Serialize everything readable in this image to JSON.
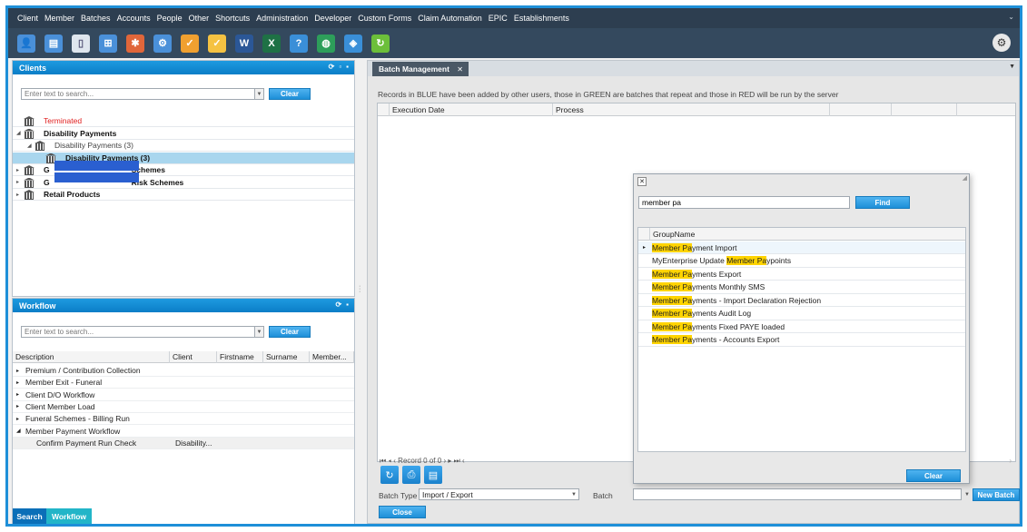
{
  "menu": [
    "Client",
    "Member",
    "Batches",
    "Accounts",
    "People",
    "Other",
    "Shortcuts",
    "Administration",
    "Developer",
    "Custom Forms",
    "Claim Automation",
    "EPIC",
    "Establishments"
  ],
  "toolbar_icons": [
    {
      "name": "people-icon",
      "color": "#4a90d9",
      "glyph": "👤"
    },
    {
      "name": "id-card-icon",
      "color": "#4a90d9",
      "glyph": "▤"
    },
    {
      "name": "document-icon",
      "color": "#dfe6ee",
      "glyph": "▯"
    },
    {
      "name": "hierarchy-icon",
      "color": "#4a90d9",
      "glyph": "⊞"
    },
    {
      "name": "molecule-icon",
      "color": "#e0663a",
      "glyph": "✱"
    },
    {
      "name": "user-settings-icon",
      "color": "#4a90d9",
      "glyph": "⚙"
    },
    {
      "name": "checklist-icon",
      "color": "#f0a030",
      "glyph": "✓"
    },
    {
      "name": "clipboard-check-icon",
      "color": "#f5c242",
      "glyph": "✓"
    },
    {
      "name": "word-icon",
      "color": "#2b5797",
      "glyph": "W"
    },
    {
      "name": "excel-icon",
      "color": "#1e7145",
      "glyph": "X"
    },
    {
      "name": "help-icon",
      "color": "#3a8fd8",
      "glyph": "?"
    },
    {
      "name": "globe-icon",
      "color": "#2d9e5a",
      "glyph": "◍"
    },
    {
      "name": "security-user-icon",
      "color": "#3a8fd8",
      "glyph": "◈"
    },
    {
      "name": "refresh-icon",
      "color": "#6cbf3a",
      "glyph": "↻"
    }
  ],
  "clients": {
    "title": "Clients",
    "search_placeholder": "Enter text to search...",
    "clear_label": "Clear",
    "tree": [
      {
        "label": "Terminated",
        "level": 0,
        "color": "#e02020",
        "bold": false,
        "arrow": "",
        "selected": false
      },
      {
        "label": "Disability Payments",
        "level": 0,
        "color": "#111111",
        "bold": true,
        "arrow": "◢",
        "selected": false
      },
      {
        "label": "Disability Payments (3)",
        "level": 1,
        "color": "#444444",
        "bold": false,
        "arrow": "◢",
        "selected": false
      },
      {
        "label": "Disability Payments (3)",
        "level": 2,
        "color": "#111111",
        "bold": true,
        "arrow": "",
        "selected": true
      },
      {
        "label": "Schemes",
        "level": 0,
        "color": "#111111",
        "bold": true,
        "arrow": "▸",
        "selected": false,
        "redacted": true,
        "prefix": "G"
      },
      {
        "label": "Risk Schemes",
        "level": 0,
        "color": "#111111",
        "bold": true,
        "arrow": "▸",
        "selected": false,
        "redacted": true,
        "prefix": "G"
      },
      {
        "label": "Retail Products",
        "level": 0,
        "color": "#111111",
        "bold": true,
        "arrow": "▸",
        "selected": false
      }
    ]
  },
  "workflow": {
    "title": "Workflow",
    "search_placeholder": "Enter text to search...",
    "clear_label": "Clear",
    "columns": [
      "Description",
      "Client",
      "Firstname",
      "Surname",
      "Member..."
    ],
    "rows": [
      {
        "label": "Premium / Contribution Collection",
        "arrow": "▸",
        "client": ""
      },
      {
        "label": "Member Exit - Funeral",
        "arrow": "▸",
        "client": ""
      },
      {
        "label": "Client D/O Workflow",
        "arrow": "▸",
        "client": ""
      },
      {
        "label": "Client Member Load",
        "arrow": "▸",
        "client": ""
      },
      {
        "label": "Funeral Schemes - Billing Run",
        "arrow": "▸",
        "client": ""
      },
      {
        "label": "Member Payment Workflow",
        "arrow": "◢",
        "client": ""
      },
      {
        "label": "Confirm Payment Run Check",
        "arrow": "",
        "client": "Disability...",
        "child": true
      }
    ]
  },
  "bottom_tabs": {
    "search": "Search",
    "workflow": "Workflow"
  },
  "main": {
    "tab_label": "Batch Management",
    "info": "Records in BLUE have been added by other users, those in GREEN are batches that repeat and those in RED will be run by the server",
    "columns": [
      "Execution Date",
      "Process"
    ],
    "record_text": "Record 0 of 0",
    "batch_type_label": "Batch Type",
    "batch_type_value": "Import / Export",
    "batch_label": "Batch",
    "batch_value": "",
    "new_batch_label": "New Batch",
    "close_label": "Close"
  },
  "popup": {
    "search_value": "member pa",
    "find_label": "Find",
    "column": "GroupName",
    "clear_label": "Clear",
    "results": [
      {
        "pre": "",
        "hl": "Member Pa",
        "post": "yment Import"
      },
      {
        "pre": "MyEnterprise Update ",
        "hl": "Member Pa",
        "post": "ypoints"
      },
      {
        "pre": "",
        "hl": "Member Pa",
        "post": "yments Export"
      },
      {
        "pre": "",
        "hl": "Member Pa",
        "post": "yments Monthly SMS"
      },
      {
        "pre": "",
        "hl": "Member Pa",
        "post": "yments - Import Declaration Rejection"
      },
      {
        "pre": "",
        "hl": "Member Pa",
        "post": "yments Audit Log"
      },
      {
        "pre": "",
        "hl": "Member Pa",
        "post": "yments Fixed PAYE loaded"
      },
      {
        "pre": "",
        "hl": "Member Pa",
        "post": "yments - Accounts Export"
      }
    ]
  }
}
